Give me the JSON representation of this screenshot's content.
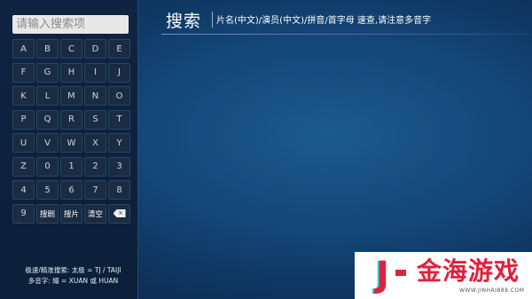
{
  "search": {
    "placeholder": "请输入搜索项"
  },
  "keyboard": {
    "rows": [
      [
        "A",
        "B",
        "C",
        "D",
        "E"
      ],
      [
        "F",
        "G",
        "H",
        "I",
        "J"
      ],
      [
        "K",
        "L",
        "M",
        "N",
        "O"
      ],
      [
        "P",
        "Q",
        "R",
        "S",
        "T"
      ],
      [
        "U",
        "V",
        "W",
        "X",
        "Y"
      ],
      [
        "Z",
        "0",
        "1",
        "2",
        "3"
      ],
      [
        "4",
        "5",
        "6",
        "7",
        "8"
      ]
    ],
    "bottom_row": {
      "digit": "9",
      "search_drama": "搜剧",
      "search_movie": "搜片",
      "clear": "清空",
      "backspace_icon": "backspace-icon",
      "backspace_mark": "×"
    }
  },
  "hints": {
    "line1": "极速/精准搜索: 太极 = TJ / TAIJI",
    "line2": "多音字: 嬛 = XUAN 或 HUAN"
  },
  "header": {
    "title": "搜索",
    "hint": "片名(中文)/演员(中文)/拼音/首字母 速查,请注意多音字"
  },
  "watermark": {
    "logo_letter": "J",
    "name": "金海游戏",
    "url": "WWW.JINHAI888.COM"
  },
  "colors": {
    "background": "#14477a",
    "panel": "#0c1f3a",
    "key": "#1a2b42",
    "watermark_red": "#e0213b",
    "watermark_cyan": "#2ad2e6"
  }
}
